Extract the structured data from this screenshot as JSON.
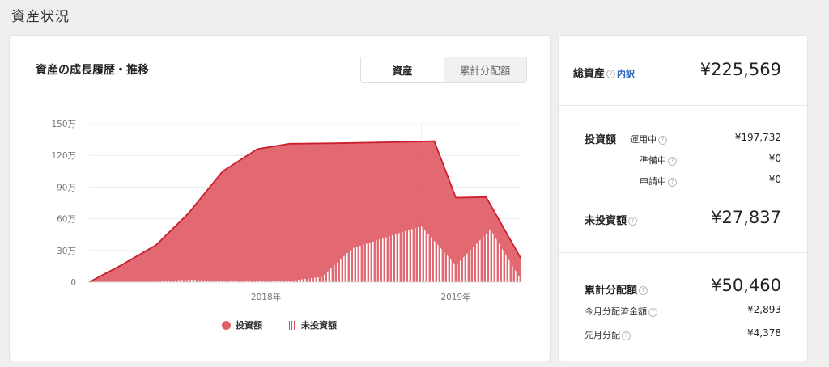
{
  "page": {
    "title": "資産状況"
  },
  "chart_card": {
    "title": "資産の成長履歴・推移",
    "toggle": {
      "active": "資産",
      "inactive": "累計分配額"
    }
  },
  "chart_data": {
    "type": "area",
    "x_tick_labels": [
      "2018年",
      "2019年"
    ],
    "y_tick_labels": [
      "150万",
      "120万",
      "90万",
      "60万",
      "30万",
      "0"
    ],
    "ylim": [
      0,
      1500000
    ],
    "xlim": [
      0,
      1
    ],
    "grid": true,
    "legend_position": "bottom",
    "series": [
      {
        "name": "投資額",
        "color": "#e06069",
        "style": "filled-area",
        "points": [
          [
            0.0,
            0
          ],
          [
            0.07,
            150000
          ],
          [
            0.155,
            350000
          ],
          [
            0.23,
            650000
          ],
          [
            0.31,
            1050000
          ],
          [
            0.39,
            1260000
          ],
          [
            0.465,
            1310000
          ],
          [
            0.57,
            1315000
          ],
          [
            0.7,
            1325000
          ],
          [
            0.8,
            1335000
          ],
          [
            0.85,
            800000
          ],
          [
            0.92,
            805000
          ],
          [
            1.0,
            230000
          ]
        ]
      },
      {
        "name": "未投資額",
        "color": "#ffffff",
        "style": "hatched-area",
        "points": [
          [
            0.0,
            0
          ],
          [
            0.1,
            0
          ],
          [
            0.16,
            5000
          ],
          [
            0.23,
            25000
          ],
          [
            0.31,
            8000
          ],
          [
            0.46,
            10000
          ],
          [
            0.54,
            50000
          ],
          [
            0.61,
            320000
          ],
          [
            0.7,
            440000
          ],
          [
            0.77,
            530000
          ],
          [
            0.85,
            160000
          ],
          [
            0.93,
            500000
          ],
          [
            1.0,
            30000
          ]
        ]
      }
    ]
  },
  "legend": {
    "invested": "投資額",
    "uninvested": "未投資額"
  },
  "summary": {
    "total_label": "総資産",
    "breakdown_link": "内訳",
    "total_value": "¥225,569",
    "invest_label": "投資額",
    "running_label": "運用中",
    "running_value": "¥197,732",
    "preparing_label": "準備中",
    "preparing_value": "¥0",
    "applying_label": "申請中",
    "applying_value": "¥0",
    "uninvested_label": "未投資額",
    "uninvested_value": "¥27,837",
    "cum_dist_label": "累計分配額",
    "cum_dist_value": "¥50,460",
    "month_dist_label": "今月分配済金額",
    "month_dist_value": "¥2,893",
    "last_month_label": "先月分配",
    "last_month_value": "¥4,378"
  },
  "icons": {
    "help": "question-circle-icon"
  }
}
